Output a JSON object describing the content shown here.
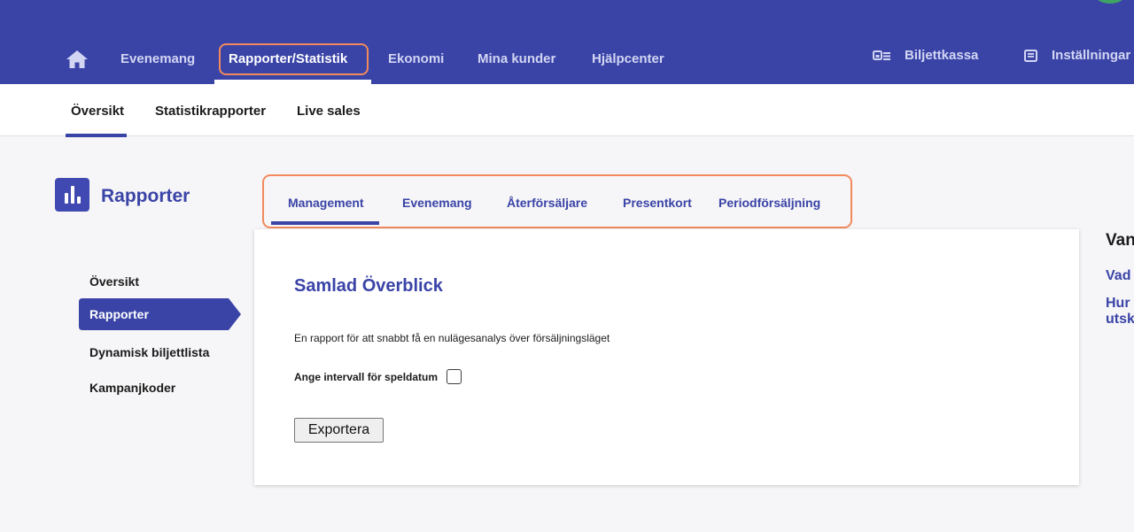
{
  "colors": {
    "brand": "#3a44a7",
    "highlight": "#f28a5c",
    "avatar": "#3fa364"
  },
  "topnav": {
    "home_icon": "home-icon",
    "items": [
      {
        "label": "Evenemang"
      },
      {
        "label": "Rapporter/Statistik",
        "active": true
      },
      {
        "label": "Ekonomi"
      },
      {
        "label": "Mina kunder"
      },
      {
        "label": "Hjälpcenter"
      }
    ],
    "right": [
      {
        "label": "Biljettkassa",
        "icon": "ticket-office-icon"
      },
      {
        "label": "Inställningar",
        "icon": "settings-icon"
      }
    ]
  },
  "subnav": {
    "items": [
      {
        "label": "Översikt",
        "active": true
      },
      {
        "label": "Statistikrapporter"
      },
      {
        "label": "Live sales"
      }
    ]
  },
  "section": {
    "title": "Rapporter",
    "icon": "bar-chart-icon"
  },
  "sidebar": {
    "items": [
      {
        "label": "Översikt"
      },
      {
        "label": "Rapporter",
        "active": true
      },
      {
        "label": "Dynamisk biljettlista"
      },
      {
        "label": "Kampanjkoder"
      }
    ]
  },
  "tabs": [
    {
      "label": "Management",
      "active": true
    },
    {
      "label": "Evenemang"
    },
    {
      "label": "Återförsäljare"
    },
    {
      "label": "Presentkort"
    },
    {
      "label": "Periodförsäljning"
    }
  ],
  "card": {
    "title": "Samlad Överblick",
    "description": "En rapport för att snabbt få en nulägesanalys över försäljningsläget",
    "checkbox_label": "Ange intervall för speldatum",
    "checkbox_checked": false,
    "export_label": "Exportera"
  },
  "right_panel": {
    "heading": "Van",
    "links": [
      "Vad",
      "Hur",
      "utsk"
    ]
  }
}
